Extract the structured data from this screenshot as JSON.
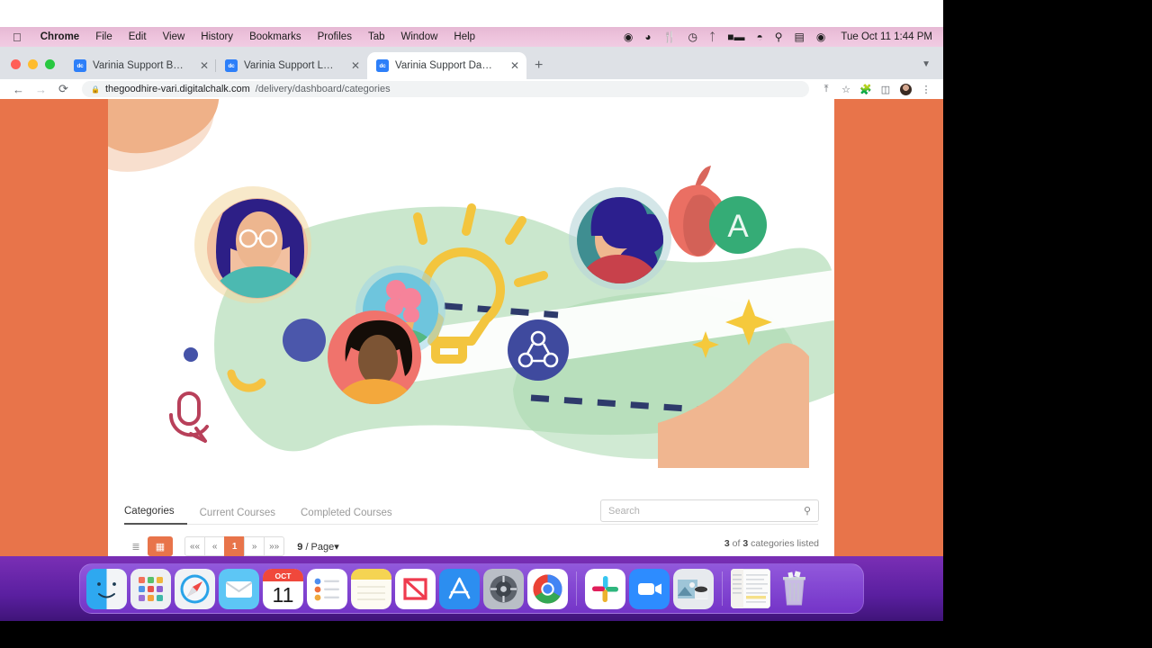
{
  "os": {
    "menubar": {
      "apple_icon": "apple-logo",
      "items": [
        "Chrome",
        "File",
        "Edit",
        "View",
        "History",
        "Bookmarks",
        "Profiles",
        "Tab",
        "Window",
        "Help"
      ],
      "app_name": "Chrome",
      "status_icons": [
        "grammarly-icon",
        "creative-cloud-icon",
        "utensils-icon",
        "clock-icon",
        "bluetooth-icon",
        "battery-icon",
        "wifi-icon",
        "spotlight-search-icon",
        "display-icon",
        "control-center-icon"
      ],
      "clock": "Tue Oct 11  1:44 PM"
    },
    "dock": {
      "items": [
        {
          "name": "finder",
          "running": true
        },
        {
          "name": "launchpad",
          "running": false
        },
        {
          "name": "safari",
          "running": true
        },
        {
          "name": "mail",
          "running": false
        },
        {
          "name": "calendar",
          "running": true,
          "month": "OCT",
          "day": "11"
        },
        {
          "name": "reminders",
          "running": true
        },
        {
          "name": "notes",
          "running": false
        },
        {
          "name": "news",
          "running": false
        },
        {
          "name": "app-store",
          "running": false
        },
        {
          "name": "system-preferences",
          "running": false
        },
        {
          "name": "google-chrome",
          "running": true
        },
        {
          "name": "slack",
          "running": true
        },
        {
          "name": "zoom",
          "running": true
        },
        {
          "name": "photos-app",
          "running": true
        },
        {
          "name": "document-window",
          "running": false
        },
        {
          "name": "trash",
          "running": false
        }
      ]
    }
  },
  "browser": {
    "window_controls": [
      "close",
      "minimize",
      "maximize"
    ],
    "tabs": [
      {
        "title": "Varinia Support Brands",
        "favicon_label": "dc",
        "active": false
      },
      {
        "title": "Varinia Support Login",
        "favicon_label": "dc",
        "active": false
      },
      {
        "title": "Varinia Support Dashboard",
        "favicon_label": "dc",
        "active": true
      }
    ],
    "new_tab_label": "+",
    "tab_list_icon": "chevron-down-icon",
    "toolbar": {
      "back_icon": "←",
      "forward_icon": "→",
      "reload_icon": "⟳",
      "lock_icon": "lock-icon",
      "url_host": "thegoodhire-vari.digitalchalk.com",
      "url_path": "/delivery/dashboard/categories",
      "share_icon": "share-icon",
      "bookmark_icon": "star-icon",
      "extensions_icon": "puzzle-icon",
      "sidepanel_icon": "side-panel-icon",
      "profile_icon": "avatar",
      "menu_icon": "three-dot-menu-icon"
    }
  },
  "page": {
    "background_color": "#e8744a",
    "card_color": "#ffffff",
    "accent_color": "#e8744a",
    "hero": {
      "alt": "dashboard-hero-illustration",
      "elements": [
        "person-avatar-glasses",
        "person-avatar-plant",
        "person-avatar-curly-hair",
        "person-avatar-redshirt",
        "apple",
        "grade-a-badge",
        "network-share-badge",
        "lightbulb",
        "stars",
        "microphone",
        "dashed-path"
      ],
      "badge_letter": "A"
    },
    "tabs": [
      {
        "label": "Categories",
        "active": true
      },
      {
        "label": "Current Courses",
        "active": false
      },
      {
        "label": "Completed Courses",
        "active": false
      }
    ],
    "search": {
      "placeholder": "Search",
      "value": "",
      "icon": "search-icon"
    },
    "view_toggle": [
      {
        "name": "list-view",
        "icon": "list-icon",
        "active": false
      },
      {
        "name": "grid-view",
        "icon": "grid-icon",
        "active": true
      }
    ],
    "pagination": {
      "first_label": "««",
      "prev_label": "«",
      "pages": [
        "1"
      ],
      "current_page": "1",
      "next_label": "»",
      "last_label": "»»"
    },
    "per_page": {
      "value": "9",
      "suffix": "/ Page",
      "caret": "▾"
    },
    "result_count": {
      "shown": "3",
      "mid": "of",
      "total": "3",
      "suffix": "categories listed"
    }
  }
}
